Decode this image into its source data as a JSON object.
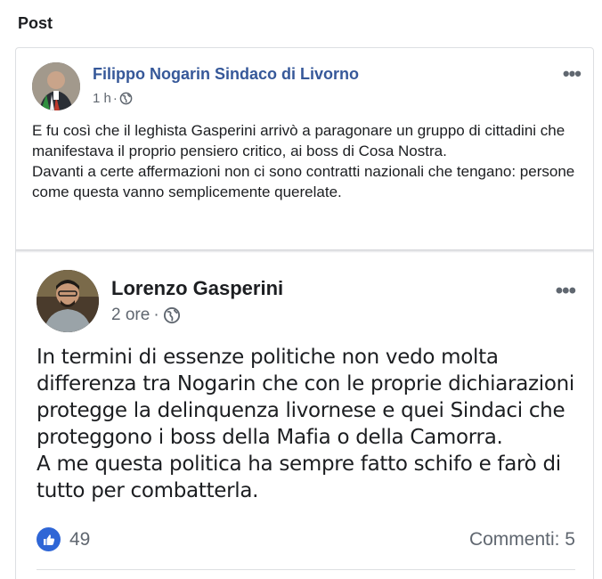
{
  "section": {
    "title": "Post"
  },
  "post": {
    "author": "Filippo Nogarin Sindaco di Livorno",
    "time": "1 h",
    "separator": "·",
    "paragraphs": [
      "E fu così che il leghista Gasperini arrivò a paragonare un gruppo di cittadini che manifestava il proprio pensiero critico, ai boss di Cosa Nostra.",
      "Davanti a certe affermazioni non ci sono contratti nazionali che tengano: persone come questa vanno semplicemente querelate."
    ],
    "more_label": "•••"
  },
  "shared_post": {
    "author": "Lorenzo Gasperini",
    "time": "2 ore",
    "separator": "·",
    "more_label": "•••",
    "lines": [
      "In termini di essenze politiche non vedo molta",
      "differenza tra Nogarin che con le proprie dichiarazioni",
      "protegge la delinquenza livornese e quei Sindaci che",
      "proteggono i boss della Mafia o della Camorra.",
      "A me questa politica ha sempre fatto schifo e farò di",
      "tutto per combatterla."
    ],
    "likes": "49",
    "comments": "Commenti: 5"
  },
  "icons": {
    "privacy": "globe-icon",
    "like": "thumbs-up-icon",
    "more": "more-options-icon"
  },
  "colors": {
    "author_link": "#365899",
    "like_blue": "#2f66d6",
    "meta_grey": "#606770"
  }
}
